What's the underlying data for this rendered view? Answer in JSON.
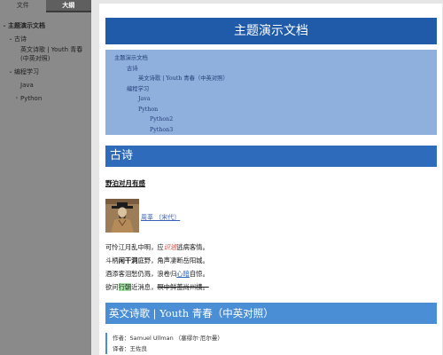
{
  "sidebar": {
    "tabs": [
      {
        "label": "文件",
        "active": false
      },
      {
        "label": "大纲",
        "active": true
      }
    ],
    "outline": {
      "root": "主题演示文档",
      "gushi": "古诗",
      "gushi_child_1": "英文诗歌 | Youth 青春",
      "gushi_child_2": "(中英对照)",
      "biancheng": "编程学习",
      "java": "Java",
      "python": "Python"
    }
  },
  "main": {
    "doc_title": "主题演示文档",
    "toc": {
      "t1": "主题演示文档",
      "t2a": "古诗",
      "t3a": "英文诗歌 | Youth 青春（中英对照）",
      "t2b": "编程学习",
      "t3b": "Java",
      "t3c": "Python",
      "t4a": "Python2",
      "t4b": "Python3"
    },
    "section_gushi": "古诗",
    "poem_title": "野泊对月有感",
    "author": "周莘 〔宋代〕",
    "poem": {
      "l1a": "可怜江月乱中明，应",
      "l1b": "识",
      "l1c": "逃",
      "l1d": "逃病客情。",
      "l2a": "斗柄",
      "l2b": "闲干洞",
      "l2c": "庭野，角声凄断岳阳城。",
      "l3a": "酒添客泪愁仍溅，浪卷归",
      "l3b": "心",
      "l3c": "暗",
      "l3d": "自惊。",
      "l4a": "欲问",
      "l4b": "行朝",
      "l4c": "近消息，",
      "l4d": "瞑中鲜蓋尚州横。"
    },
    "section_youth": "英文诗歌 | Youth 青春（中英对照）",
    "quote": {
      "author": "作者：Samuel Ullman （塞缪尔·厄尔曼）",
      "translator": "译者：王佐良"
    }
  }
}
